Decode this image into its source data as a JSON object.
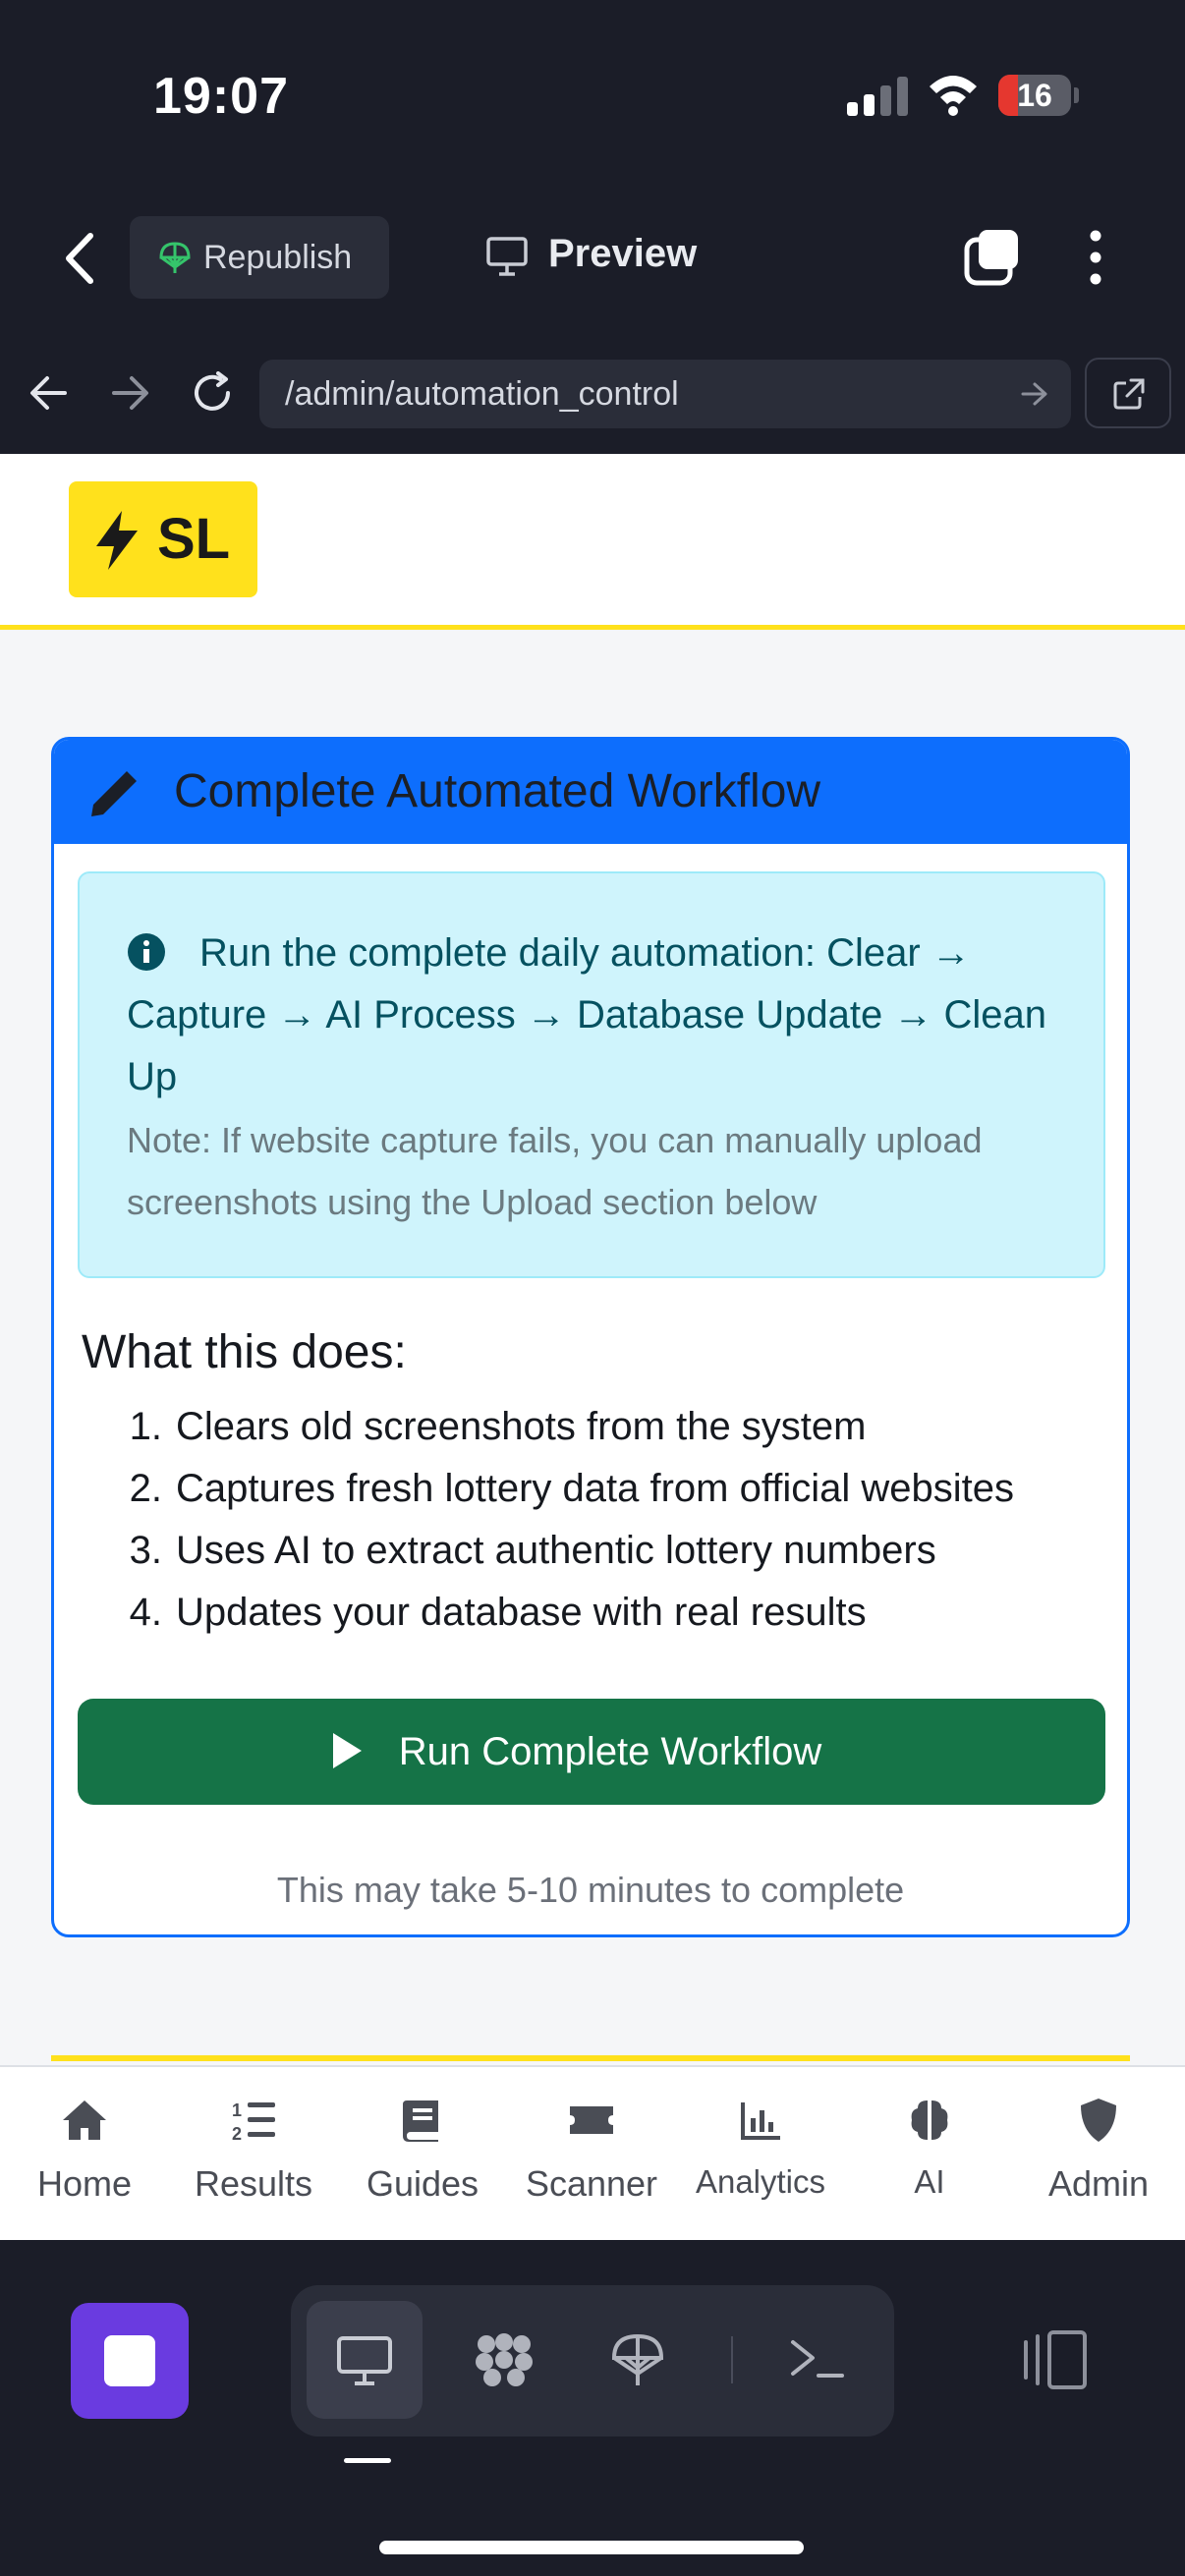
{
  "status_bar": {
    "time": "19:07",
    "battery": "16"
  },
  "top_bar": {
    "republish_label": "Republish",
    "preview_label": "Preview"
  },
  "url_bar": {
    "url": "/admin/automation_control"
  },
  "site": {
    "logo_text": "SL"
  },
  "workflow_card": {
    "title": "Complete Automated Workflow",
    "alert_text": "Run the complete daily automation: Clear → Capture → AI Process → Database Update → Clean Up",
    "alert_note": "Note: If website capture fails, you can manually upload screenshots using the Upload section below",
    "what_heading": "What this does:",
    "steps": [
      "Clears old screenshots from the system",
      "Captures fresh lottery data from official websites",
      "Uses AI to extract authentic lottery numbers",
      "Updates your database with real results"
    ],
    "run_button": "Run Complete Workflow",
    "run_note": "This may take 5-10 minutes to complete"
  },
  "bottom_nav": {
    "items": [
      {
        "label": "Home",
        "icon": "home-icon"
      },
      {
        "label": "Results",
        "icon": "list-ol-icon"
      },
      {
        "label": "Guides",
        "icon": "book-icon"
      },
      {
        "label": "Scanner",
        "icon": "ticket-icon"
      },
      {
        "label": "Analytics",
        "icon": "chart-line-icon"
      },
      {
        "label": "AI",
        "icon": "brain-icon"
      },
      {
        "label": "Admin",
        "icon": "shield-icon"
      }
    ]
  },
  "colors": {
    "brand_yellow": "#ffe11c",
    "primary_blue": "#0d6efd",
    "success_green": "#157347",
    "info_bg": "#cff4fc",
    "replit_accent": "#6a3be0"
  }
}
